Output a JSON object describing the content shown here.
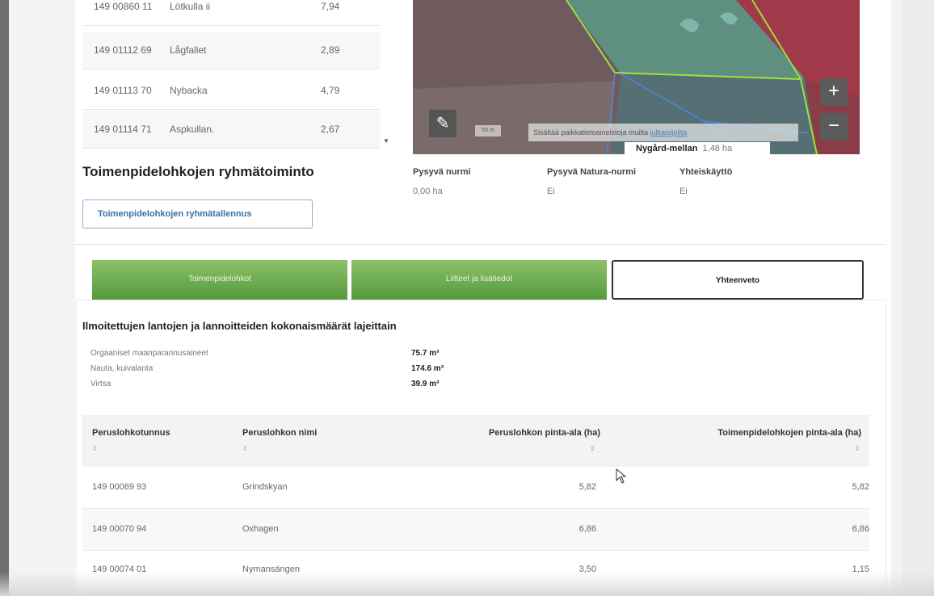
{
  "parcels": [
    {
      "id": "149 00860 11",
      "name": "Lötkulla ii",
      "area": "7,94"
    },
    {
      "id": "149 01112 69",
      "name": "Lågfallet",
      "area": "2,89"
    },
    {
      "id": "149 01113 70",
      "name": "Nybacka",
      "area": "4,79"
    },
    {
      "id": "149 01114 71",
      "name": "Aspkullan.",
      "area": "2,67"
    }
  ],
  "map": {
    "scale_text": "50 m",
    "attribution_text": "Sisältää paikkatietoaineistoja muilta",
    "attribution_link": "julkaisijoilta",
    "parcel_name": "Nygård-mellan",
    "parcel_area": "1,48 ha",
    "zoom_in": "+",
    "zoom_out": "−",
    "edit_icon_glyph": "✎"
  },
  "group_section": {
    "title": "Toimenpidelohkojen ryhmätoiminto",
    "save_button": "Toimenpidelohkojen ryhmätallennus"
  },
  "properties": [
    {
      "label": "Pysyvä nurmi",
      "value": "0,00 ha"
    },
    {
      "label": "Pysyvä Natura-nurmi",
      "value": "Ei"
    },
    {
      "label": "Yhteiskäyttö",
      "value": "Ei"
    }
  ],
  "tabs": [
    {
      "label": "Toimenpidelohkot"
    },
    {
      "label": "Liitteet ja lisätiedot"
    },
    {
      "label": "Yhteenveto"
    }
  ],
  "summary": {
    "title": "Ilmoitettujen lantojen ja lannoitteiden kokonaismäärät lajeittain",
    "rows": [
      {
        "label": "Orgaaniset maanparannusaineet",
        "value": "75.7 m³"
      },
      {
        "label": "Nauta, kuivalanta",
        "value": "174.6 m³"
      },
      {
        "label": "Virtsa",
        "value": "39.9 m³"
      }
    ]
  },
  "table": {
    "headers": [
      "Peruslohkotunnus",
      "Peruslohkon nimi",
      "Peruslohkon pinta-ala (ha)",
      "Toimenpidelohkojen pinta-ala (ha)"
    ],
    "sort_glyph": "⇕",
    "rows": [
      [
        "149 00069 93",
        "Grindskyan",
        "5,82",
        "5,82"
      ],
      [
        "149 00070 94",
        "Oxhagen",
        "6,86",
        "6,86"
      ],
      [
        "149 00074 01",
        "Nymansängen",
        "3,50",
        "1,15"
      ]
    ]
  },
  "colors": {
    "tab_green": "#6aa84f",
    "link_blue": "#3a6ea5",
    "map_field_red": "#8a3a44",
    "map_boundary_green": "#9be23a"
  }
}
